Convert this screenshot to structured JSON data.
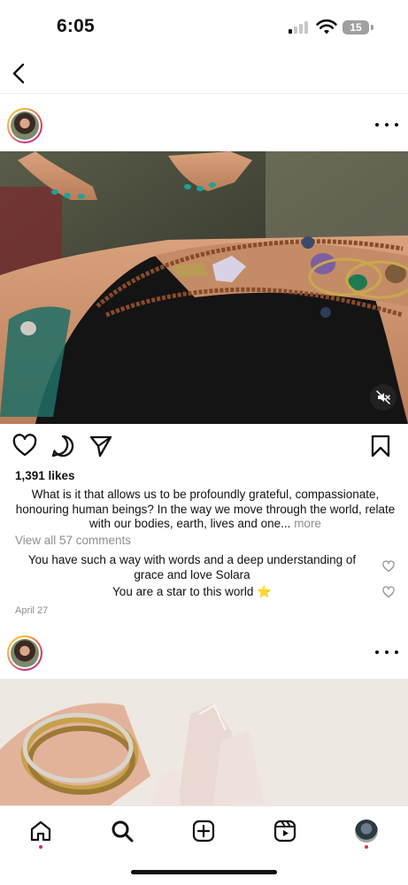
{
  "status_bar": {
    "time": "6:05",
    "battery": "15"
  },
  "header": {
    "back_icon": "chevron-left-icon"
  },
  "post1": {
    "likes": "1,391 likes",
    "caption": "What is it that allows us to be profoundly grateful, compassionate, honouring human beings? In the way we move through the world, relate with our bodies, earth, lives and one...",
    "more_label": "more",
    "view_comments": "View all 57 comments",
    "comments": [
      {
        "text": "You have such a way with words and a deep understanding of grace and love Solara"
      },
      {
        "text": "You are a star to this world ⭐"
      }
    ],
    "date": "April 27",
    "audio": "muted"
  },
  "tab_bar": {
    "items": [
      {
        "icon": "home-icon",
        "active": true
      },
      {
        "icon": "search-icon",
        "active": false
      },
      {
        "icon": "create-post-icon",
        "active": false
      },
      {
        "icon": "reels-icon",
        "active": false
      },
      {
        "icon": "profile-avatar",
        "active": false
      }
    ]
  },
  "colors": {
    "accent_red": "#e0245e",
    "muted_text": "#8e8e8e",
    "story_ring": "#e1306c"
  }
}
